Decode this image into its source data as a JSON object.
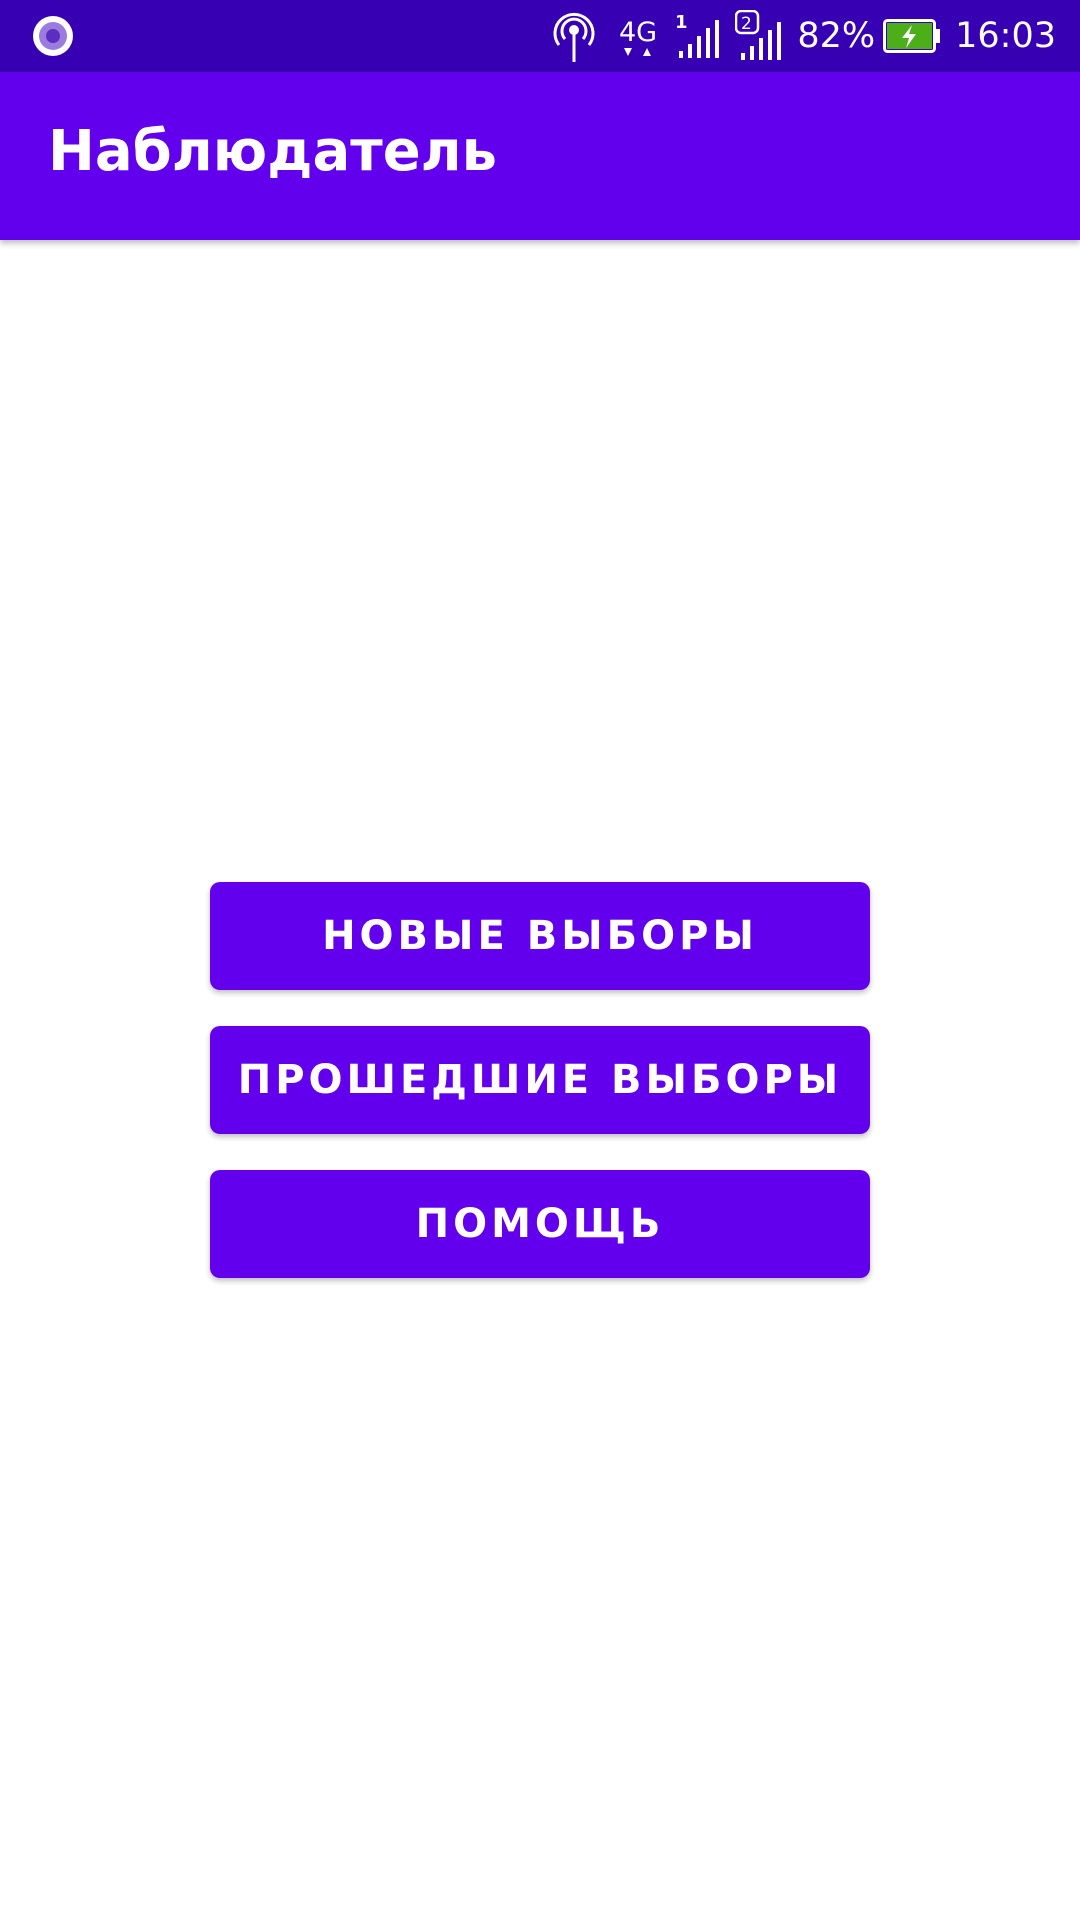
{
  "status_bar": {
    "battery": "82%",
    "time": "16:03",
    "network_type": "4G",
    "sim1_label": "1",
    "sim2_label": "2",
    "icons": [
      "notification-dot-icon",
      "hotspot-icon",
      "4g-data-icon",
      "signal-sim1-icon",
      "signal-sim2-icon",
      "battery-charging-icon"
    ],
    "colors": {
      "background": "#3700b3",
      "battery_fill": "#4caf1a"
    }
  },
  "app_bar": {
    "title": "Наблюдатель",
    "color": "#6200ee"
  },
  "main": {
    "buttons": [
      {
        "label": "НОВЫЕ ВЫБОРЫ"
      },
      {
        "label": "ПРОШЕДШИЕ ВЫБОРЫ"
      },
      {
        "label": "ПОМОЩЬ"
      }
    ],
    "button_color": "#6200ee"
  }
}
